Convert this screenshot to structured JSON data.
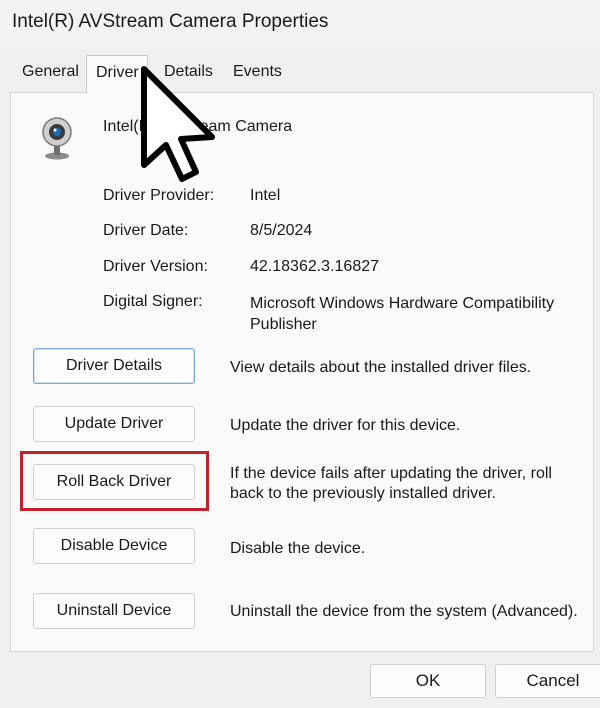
{
  "window": {
    "title": "Intel(R) AVStream Camera Properties"
  },
  "tabs": [
    {
      "label": "General",
      "selected": false
    },
    {
      "label": "Driver",
      "selected": true
    },
    {
      "label": "Details",
      "selected": false
    },
    {
      "label": "Events",
      "selected": false
    }
  ],
  "device": {
    "name": "Intel(R) AVStream Camera",
    "icon": "webcam-icon"
  },
  "info": {
    "provider_label": "Driver Provider:",
    "provider_value": "Intel",
    "date_label": "Driver Date:",
    "date_value": "8/5/2024",
    "version_label": "Driver Version:",
    "version_value": "42.18362.3.16827",
    "signer_label": "Digital Signer:",
    "signer_value": "Microsoft Windows Hardware Compatibility Publisher"
  },
  "actions": {
    "details_label": "Driver Details",
    "details_desc": "View details about the installed driver files.",
    "update_label": "Update Driver",
    "update_desc": "Update the driver for this device.",
    "rollback_label": "Roll Back Driver",
    "rollback_desc": "If the device fails after updating the driver, roll back to the previously installed driver.",
    "disable_label": "Disable Device",
    "disable_desc": "Disable the device.",
    "uninstall_label": "Uninstall Device",
    "uninstall_desc": "Uninstall the device from the system (Advanced)."
  },
  "footer": {
    "ok_label": "OK",
    "cancel_label": "Cancel"
  },
  "colors": {
    "highlight": "#c4202b",
    "focus_border": "#7aa7d6"
  }
}
